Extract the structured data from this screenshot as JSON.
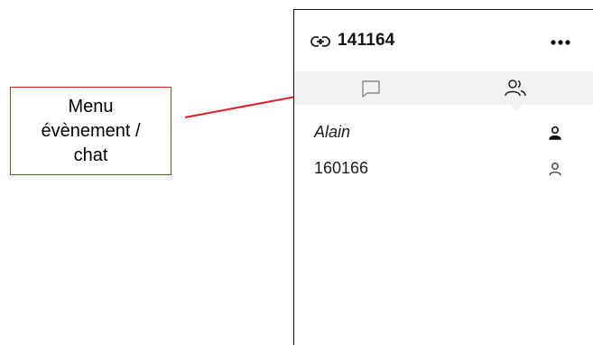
{
  "callout": {
    "lines": [
      "Menu",
      "évènement /",
      "chat"
    ],
    "border_color": "#e02020",
    "arrow_color": "#e02020"
  },
  "panel": {
    "header": {
      "link_icon": "link-icon",
      "room_id": "141164",
      "more_icon": "more-horizontal-icon"
    },
    "tabs": [
      {
        "icon": "chat-bubble-icon",
        "label": "",
        "active": false
      },
      {
        "icon": "people-icon",
        "label": "",
        "active": true
      }
    ],
    "participants": [
      {
        "name": "Alain",
        "italic": true,
        "icon": "person-filled-icon"
      },
      {
        "name": "160166",
        "italic": false,
        "icon": "person-outline-icon"
      }
    ],
    "colors": {
      "tab_bar_bg": "#f2f2f2",
      "text": "#1c1c1c"
    }
  }
}
